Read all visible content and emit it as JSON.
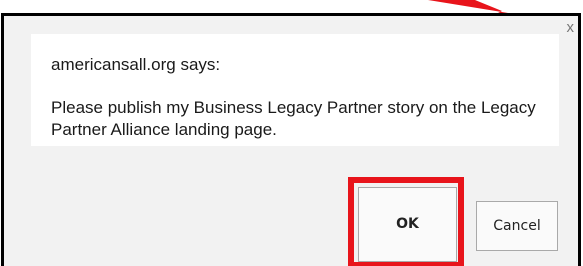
{
  "dialog": {
    "title": "americansall.org says:",
    "message": "Please publish my Business Legacy Partner story on the Legacy Partner Alliance landing page.",
    "close_glyph": "x"
  },
  "buttons": {
    "ok_label": "OK",
    "cancel_label": "Cancel"
  },
  "annotation": {
    "highlight_color": "#e8141b",
    "highlights": "ok-button",
    "arrow_icon": "arrow-icon"
  }
}
